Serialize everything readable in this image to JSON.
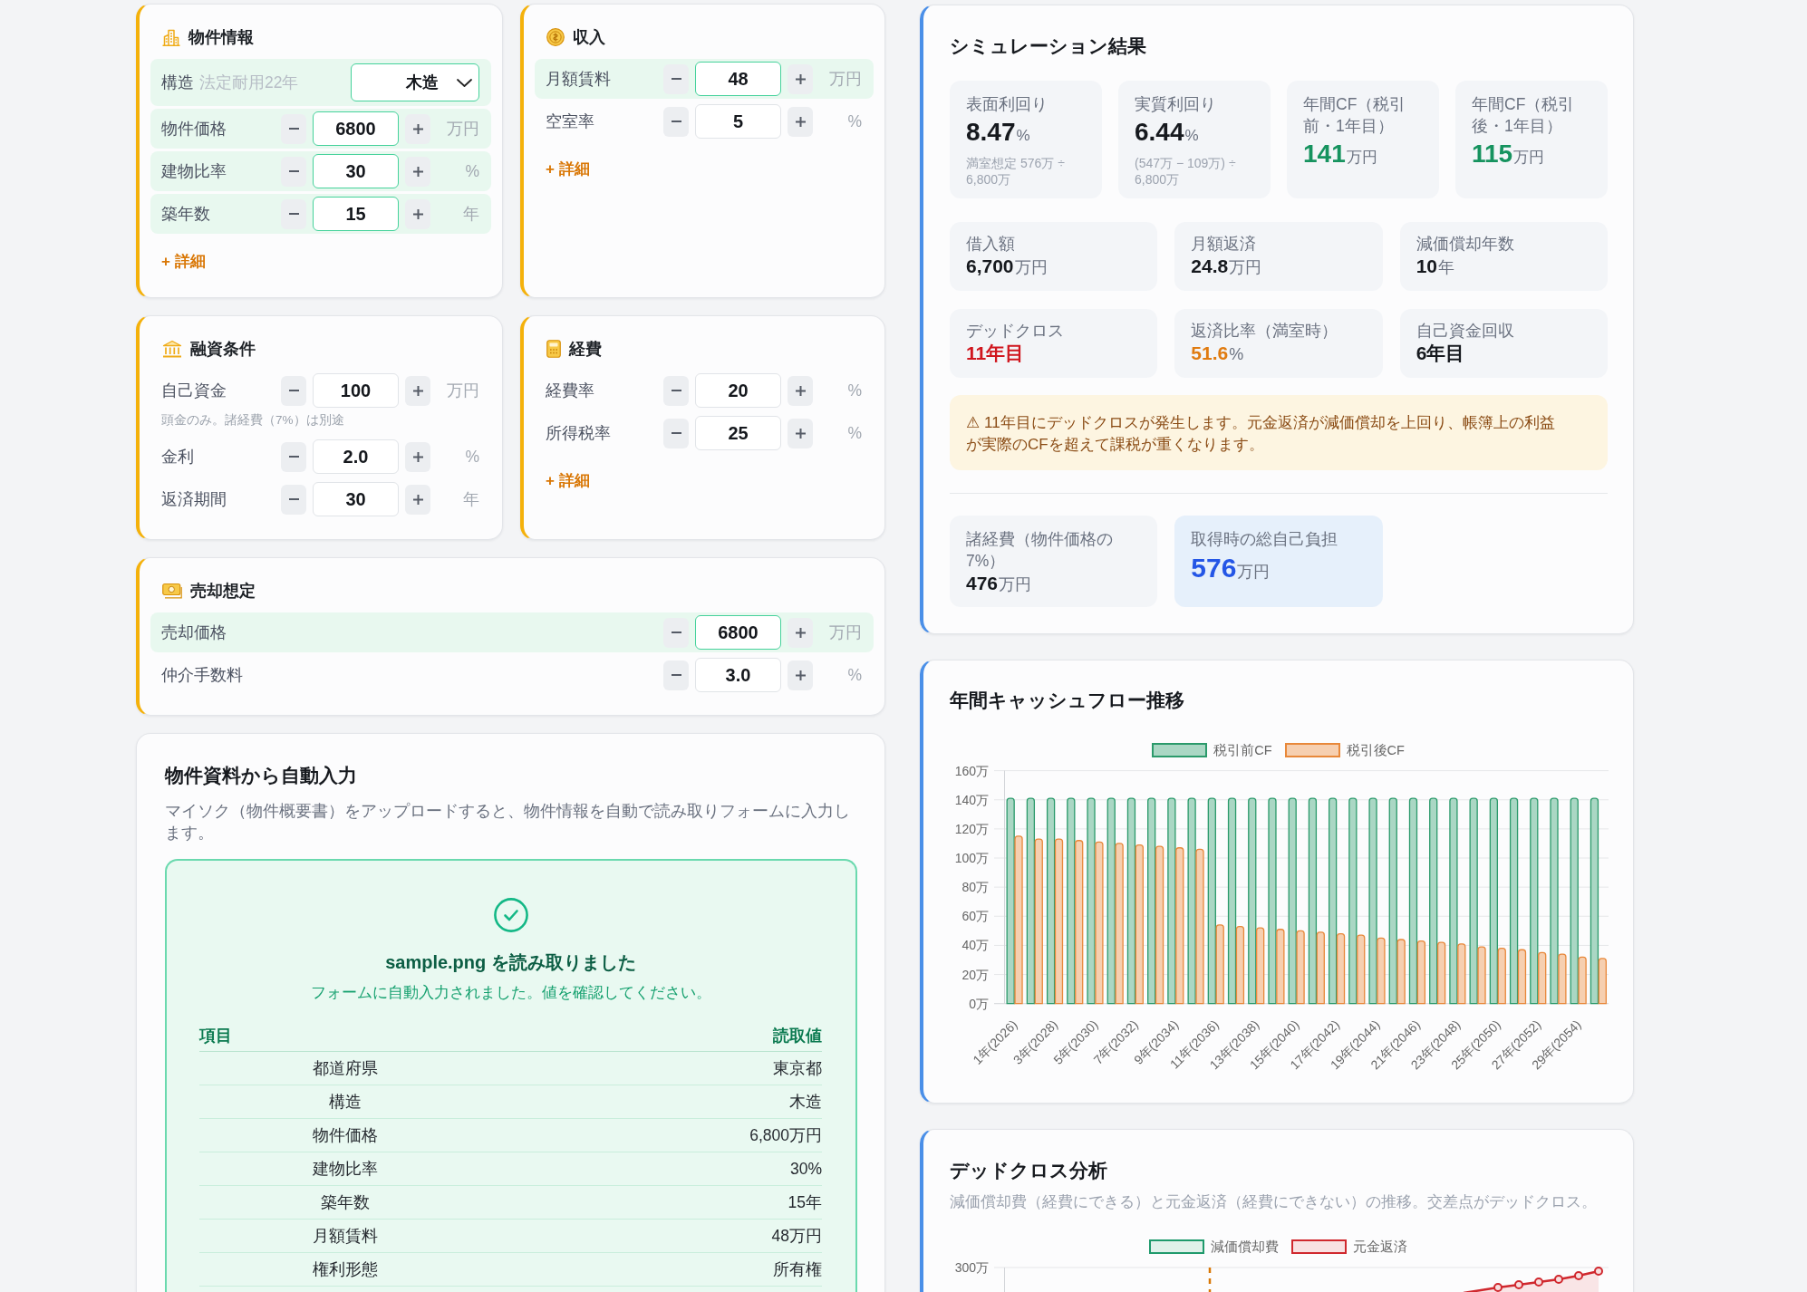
{
  "input_cards": [
    {
      "title": "物件情報",
      "rows": [
        {
          "kind": "select",
          "label": "構造",
          "hint": "法定耐用22年",
          "value": "木造",
          "highlighted": true
        },
        {
          "kind": "stepper",
          "label": "物件価格",
          "value": "6800",
          "unit": "万円",
          "highlighted": true
        },
        {
          "kind": "stepper",
          "label": "建物比率",
          "value": "30",
          "unit": "%",
          "highlighted": true
        },
        {
          "kind": "stepper",
          "label": "築年数",
          "value": "15",
          "unit": "年",
          "highlighted": true
        }
      ],
      "detail_link": "+ 詳細"
    },
    {
      "title": "収入",
      "rows": [
        {
          "kind": "stepper",
          "label": "月額賃料",
          "value": "48",
          "unit": "万円",
          "highlighted": true
        },
        {
          "kind": "stepper",
          "label": "空室率",
          "value": "5",
          "unit": "%",
          "highlighted": false
        }
      ],
      "detail_link": "+ 詳細"
    },
    {
      "title": "融資条件",
      "rows": [
        {
          "kind": "stepper",
          "label": "自己資金",
          "value": "100",
          "unit": "万円",
          "highlighted": false,
          "note": "頭金のみ。諸経費（7%）は別途"
        },
        {
          "kind": "stepper",
          "label": "金利",
          "value": "2.0",
          "unit": "%",
          "highlighted": false
        },
        {
          "kind": "stepper",
          "label": "返済期間",
          "value": "30",
          "unit": "年",
          "highlighted": false
        }
      ]
    },
    {
      "title": "経費",
      "rows": [
        {
          "kind": "stepper",
          "label": "経費率",
          "value": "20",
          "unit": "%",
          "highlighted": false
        },
        {
          "kind": "stepper",
          "label": "所得税率",
          "value": "25",
          "unit": "%",
          "highlighted": false
        }
      ],
      "detail_link": "+ 詳細"
    },
    {
      "title": "売却想定",
      "rows": [
        {
          "kind": "stepper",
          "label": "売却価格",
          "value": "6800",
          "unit": "万円",
          "highlighted": true
        },
        {
          "kind": "stepper",
          "label": "仲介手数料",
          "value": "3.0",
          "unit": "%",
          "highlighted": false
        }
      ]
    }
  ],
  "autofill": {
    "title": "物件資料から自動入力",
    "description": "マイソク（物件概要書）をアップロードすると、物件情報を自動で読み取りフォームに入力します。",
    "status_title": "sample.png を読み取りました",
    "status_message": "フォームに自動入力されました。値を確認してください。",
    "table": {
      "columns": [
        "項目",
        "読取値"
      ],
      "rows": [
        [
          "都道府県",
          "東京都"
        ],
        [
          "構造",
          "木造"
        ],
        [
          "物件価格",
          "6,800万円"
        ],
        [
          "建物比率",
          "30%"
        ],
        [
          "築年数",
          "15年"
        ],
        [
          "月額賃料",
          "48万円"
        ],
        [
          "権利形態",
          "所有権"
        ]
      ]
    }
  },
  "results": {
    "title": "シミュレーション結果",
    "primary": [
      {
        "label": "表面利回り",
        "value": "8.47",
        "unit": "%",
        "note": "満室想定 576万 ÷ 6,800万",
        "color": "#16191e"
      },
      {
        "label": "実質利回り",
        "value": "6.44",
        "unit": "%",
        "note": "(547万 − 109万) ÷ 6,800万",
        "color": "#16191e"
      },
      {
        "label": "年間CF（税引前・1年目）",
        "value": "141",
        "unit": "万円",
        "color": "#16935f"
      },
      {
        "label": "年間CF（税引後・1年目）",
        "value": "115",
        "unit": "万円",
        "color": "#16935f"
      }
    ],
    "secondary": [
      {
        "label": "借入額",
        "value": "6,700",
        "unit": "万円",
        "color": "#16191e"
      },
      {
        "label": "月額返済",
        "value": "24.8",
        "unit": "万円",
        "color": "#16191e"
      },
      {
        "label": "減価償却年数",
        "value": "10",
        "unit": "年",
        "color": "#16191e"
      },
      {
        "label": "デッドクロス",
        "value": "11年目",
        "color": "#d0161e"
      },
      {
        "label": "返済比率（満室時）",
        "value": "51.6",
        "unit": "%",
        "color": "#e07b10"
      },
      {
        "label": "自己資金回収",
        "value": "6年目",
        "color": "#16191e"
      }
    ],
    "warning": "⚠ 11年目にデッドクロスが発生します。元金返済が減価償却を上回り、帳簿上の利益が実際のCFを超えて課税が重くなります。",
    "acquisition": [
      {
        "label": "諸経費（物件価格の7%）",
        "value": "476",
        "unit": "万円",
        "highlighted": false,
        "color": "#16191e"
      },
      {
        "label": "取得時の総自己負担",
        "value": "576",
        "unit": "万円",
        "highlighted": true,
        "color": "#2456e6"
      }
    ]
  },
  "cashflow_chart": {
    "chart_data": {
      "type": "bar",
      "title": "年間キャッシュフロー推移",
      "categories": [
        "1年(2026)",
        null,
        "3年(2028)",
        null,
        "5年(2030)",
        null,
        "7年(2032)",
        null,
        "9年(2034)",
        null,
        "11年(2036)",
        null,
        "13年(2038)",
        null,
        "15年(2040)",
        null,
        "17年(2042)",
        null,
        "19年(2044)",
        null,
        "21年(2046)",
        null,
        "23年(2048)",
        null,
        "25年(2050)",
        null,
        "27年(2052)",
        null,
        "29年(2054)",
        null
      ],
      "series": [
        {
          "name": "税引前CF",
          "color": "#2b9a6b",
          "values": [
            141,
            141,
            141,
            141,
            141,
            141,
            141,
            141,
            141,
            141,
            141,
            141,
            141,
            141,
            141,
            141,
            141,
            141,
            141,
            141,
            141,
            141,
            141,
            141,
            141,
            141,
            141,
            141,
            141,
            141
          ]
        },
        {
          "name": "税引後CF",
          "color": "#e8883a",
          "values": [
            115,
            113,
            113,
            112,
            111,
            110,
            109,
            108,
            107,
            106,
            54,
            53,
            52,
            51,
            50,
            49,
            48,
            47,
            45,
            44,
            43,
            42,
            41,
            39,
            38,
            37,
            35,
            34,
            32,
            31
          ]
        }
      ],
      "ylim": [
        0,
        160
      ],
      "yticks": [
        {
          "value": 0,
          "label": "0万"
        },
        {
          "value": 20,
          "label": "20万"
        },
        {
          "value": 40,
          "label": "40万"
        },
        {
          "value": 60,
          "label": "60万"
        },
        {
          "value": 80,
          "label": "80万"
        },
        {
          "value": 100,
          "label": "100万"
        },
        {
          "value": 120,
          "label": "120万"
        },
        {
          "value": 140,
          "label": "140万"
        },
        {
          "value": 160,
          "label": "160万"
        }
      ],
      "stacked": false,
      "grid": true,
      "legend": "top"
    }
  },
  "deadcross": {
    "title": "デッドクロス分析",
    "description": "減価償却費（経費にできる）と元金返済（経費にできない）の推移。交差点がデッドクロス。",
    "legend": [
      {
        "label": "減価償却費",
        "color": "#1f9a6c"
      },
      {
        "label": "元金返済",
        "color": "#d0282e"
      }
    ],
    "axis_label": "300万"
  }
}
